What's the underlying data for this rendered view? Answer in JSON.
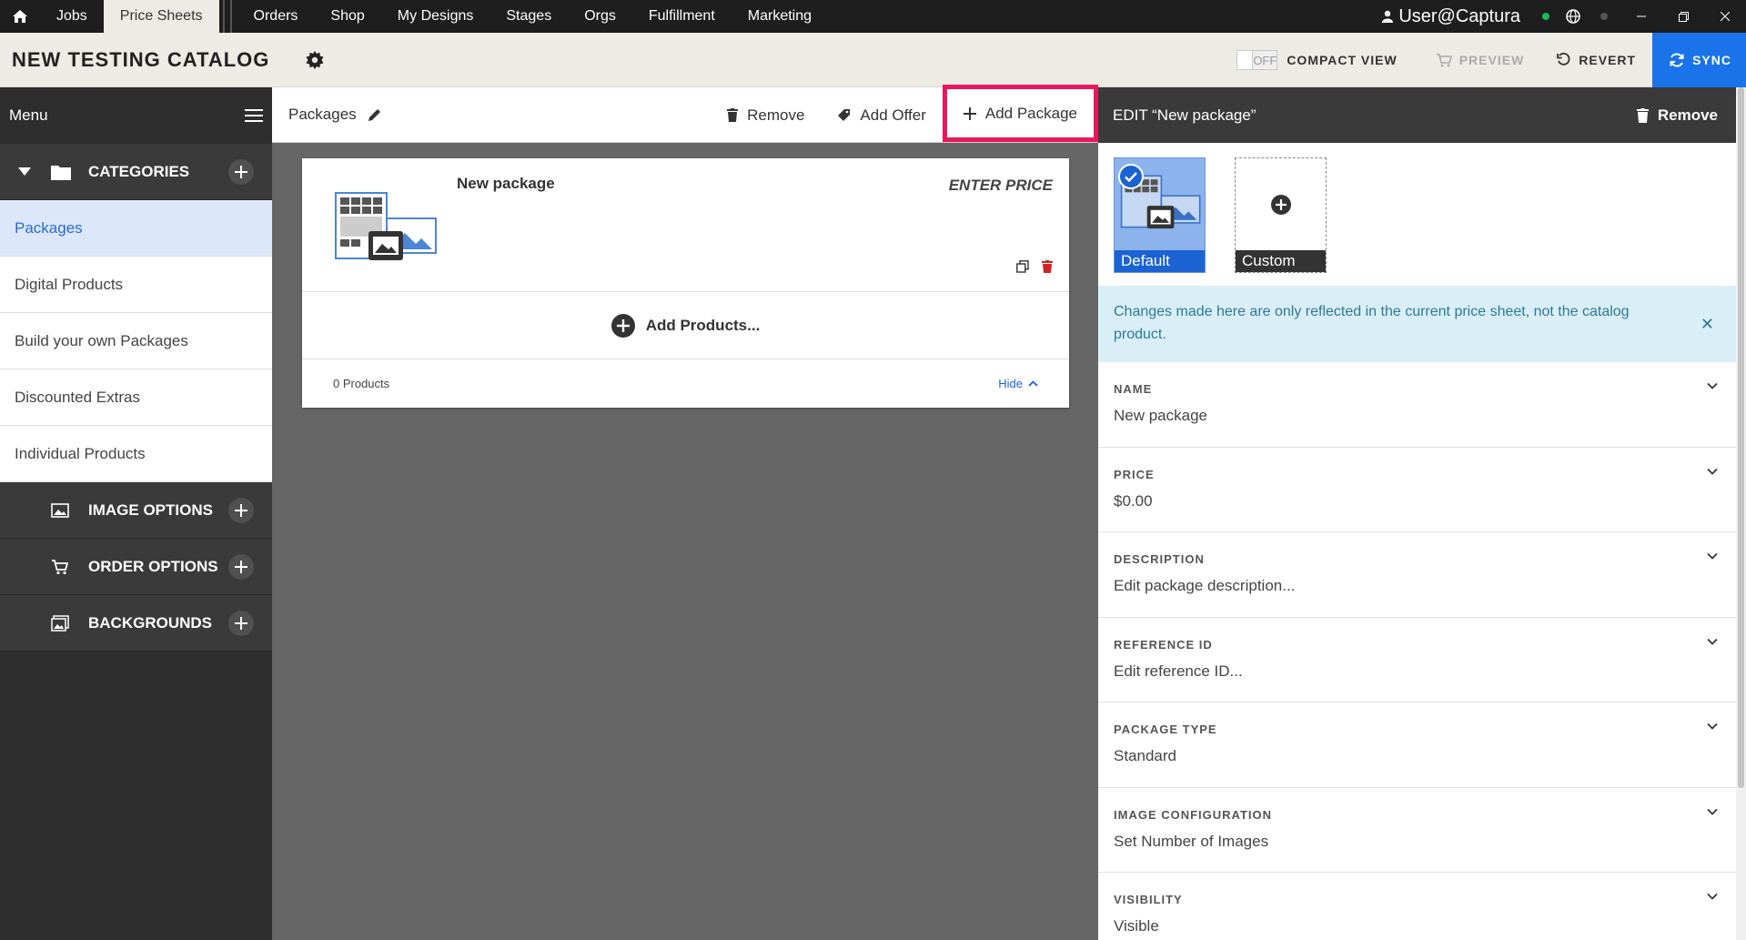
{
  "topnav": {
    "items": [
      {
        "label": "Jobs"
      },
      {
        "label": "Price Sheets"
      },
      {
        "label": "Orders"
      },
      {
        "label": "Shop"
      },
      {
        "label": "My Designs"
      },
      {
        "label": "Stages"
      },
      {
        "label": "Orgs"
      },
      {
        "label": "Fulfillment"
      },
      {
        "label": "Marketing"
      }
    ],
    "user": "User@Captura"
  },
  "header": {
    "title": "NEW TESTING CATALOG",
    "toggle_state": "OFF",
    "compact_view": "COMPACT VIEW",
    "preview": "PREVIEW",
    "revert": "REVERT",
    "sync": "SYNC"
  },
  "sidebar": {
    "menu_label": "Menu",
    "categories_label": "CATEGORIES",
    "items": [
      {
        "label": "Packages"
      },
      {
        "label": "Digital Products"
      },
      {
        "label": "Build your own Packages"
      },
      {
        "label": "Discounted Extras"
      },
      {
        "label": "Individual Products"
      }
    ],
    "sections": [
      {
        "label": "IMAGE OPTIONS"
      },
      {
        "label": "ORDER OPTIONS"
      },
      {
        "label": "BACKGROUNDS"
      }
    ]
  },
  "toolbar": {
    "crumb": "Packages",
    "remove": "Remove",
    "add_offer": "Add Offer",
    "add_package": "Add Package"
  },
  "card": {
    "name": "New package",
    "price": "ENTER PRICE",
    "add_products": "Add Products...",
    "count": "0 Products",
    "hide": "Hide"
  },
  "panel": {
    "title": "EDIT “New package”",
    "remove": "Remove",
    "options": [
      {
        "label": "Default"
      },
      {
        "label": "Custom"
      }
    ],
    "info": "Changes made here are only reflected in the current price sheet, not the catalog product.",
    "fields": [
      {
        "label": "NAME",
        "value": "New package"
      },
      {
        "label": "PRICE",
        "value": "$0.00"
      },
      {
        "label": "DESCRIPTION",
        "value": "Edit package description..."
      },
      {
        "label": "REFERENCE ID",
        "value": "Edit reference ID..."
      },
      {
        "label": "PACKAGE TYPE",
        "value": "Standard"
      },
      {
        "label": "IMAGE CONFIGURATION",
        "value": "Set Number of Images"
      },
      {
        "label": "VISIBILITY",
        "value": "Visible"
      }
    ]
  },
  "colors": {
    "accent": "#1a73e8",
    "highlight": "#e8175d",
    "selected_bg": "#dce8fa",
    "info_bg": "#daeef7"
  }
}
